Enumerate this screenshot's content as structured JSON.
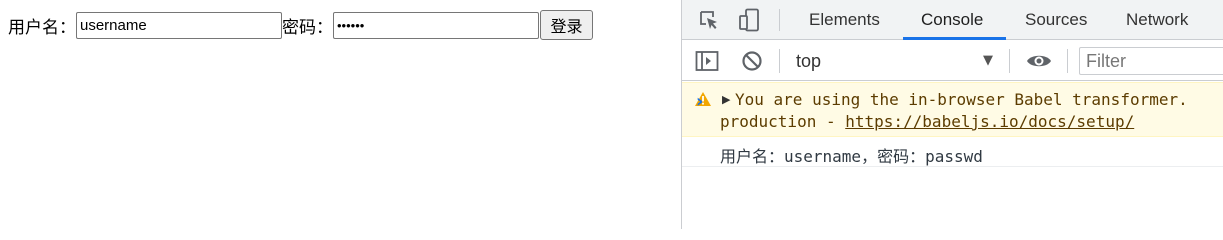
{
  "page": {
    "username_label": "用户名：",
    "username_value": "username",
    "password_label": "密码：",
    "password_value": "passwd",
    "login_button": "登录"
  },
  "devtools": {
    "tabs": [
      {
        "label": "Elements",
        "active": false
      },
      {
        "label": "Console",
        "active": true
      },
      {
        "label": "Sources",
        "active": false
      },
      {
        "label": "Network",
        "active": false
      }
    ],
    "toolbar": {
      "context": "top",
      "filter_placeholder": "Filter"
    },
    "messages": {
      "warning": {
        "line1": "You are using the in-browser Babel transformer.",
        "line2_prefix": "production - ",
        "link": "https://babeljs.io/docs/setup/"
      },
      "log": "用户名：username，密码：passwd"
    },
    "prompt_symbol": "›"
  },
  "colors": {
    "accent": "#1a73e8",
    "warning_bg": "#fffbe5",
    "warning_text": "#5c3c00",
    "warning_icon": "#f2a600"
  },
  "icons": [
    "inspect-icon",
    "device-toggle-icon",
    "sidebar-toggle-icon",
    "clear-console-icon",
    "eye-icon",
    "warning-icon"
  ]
}
